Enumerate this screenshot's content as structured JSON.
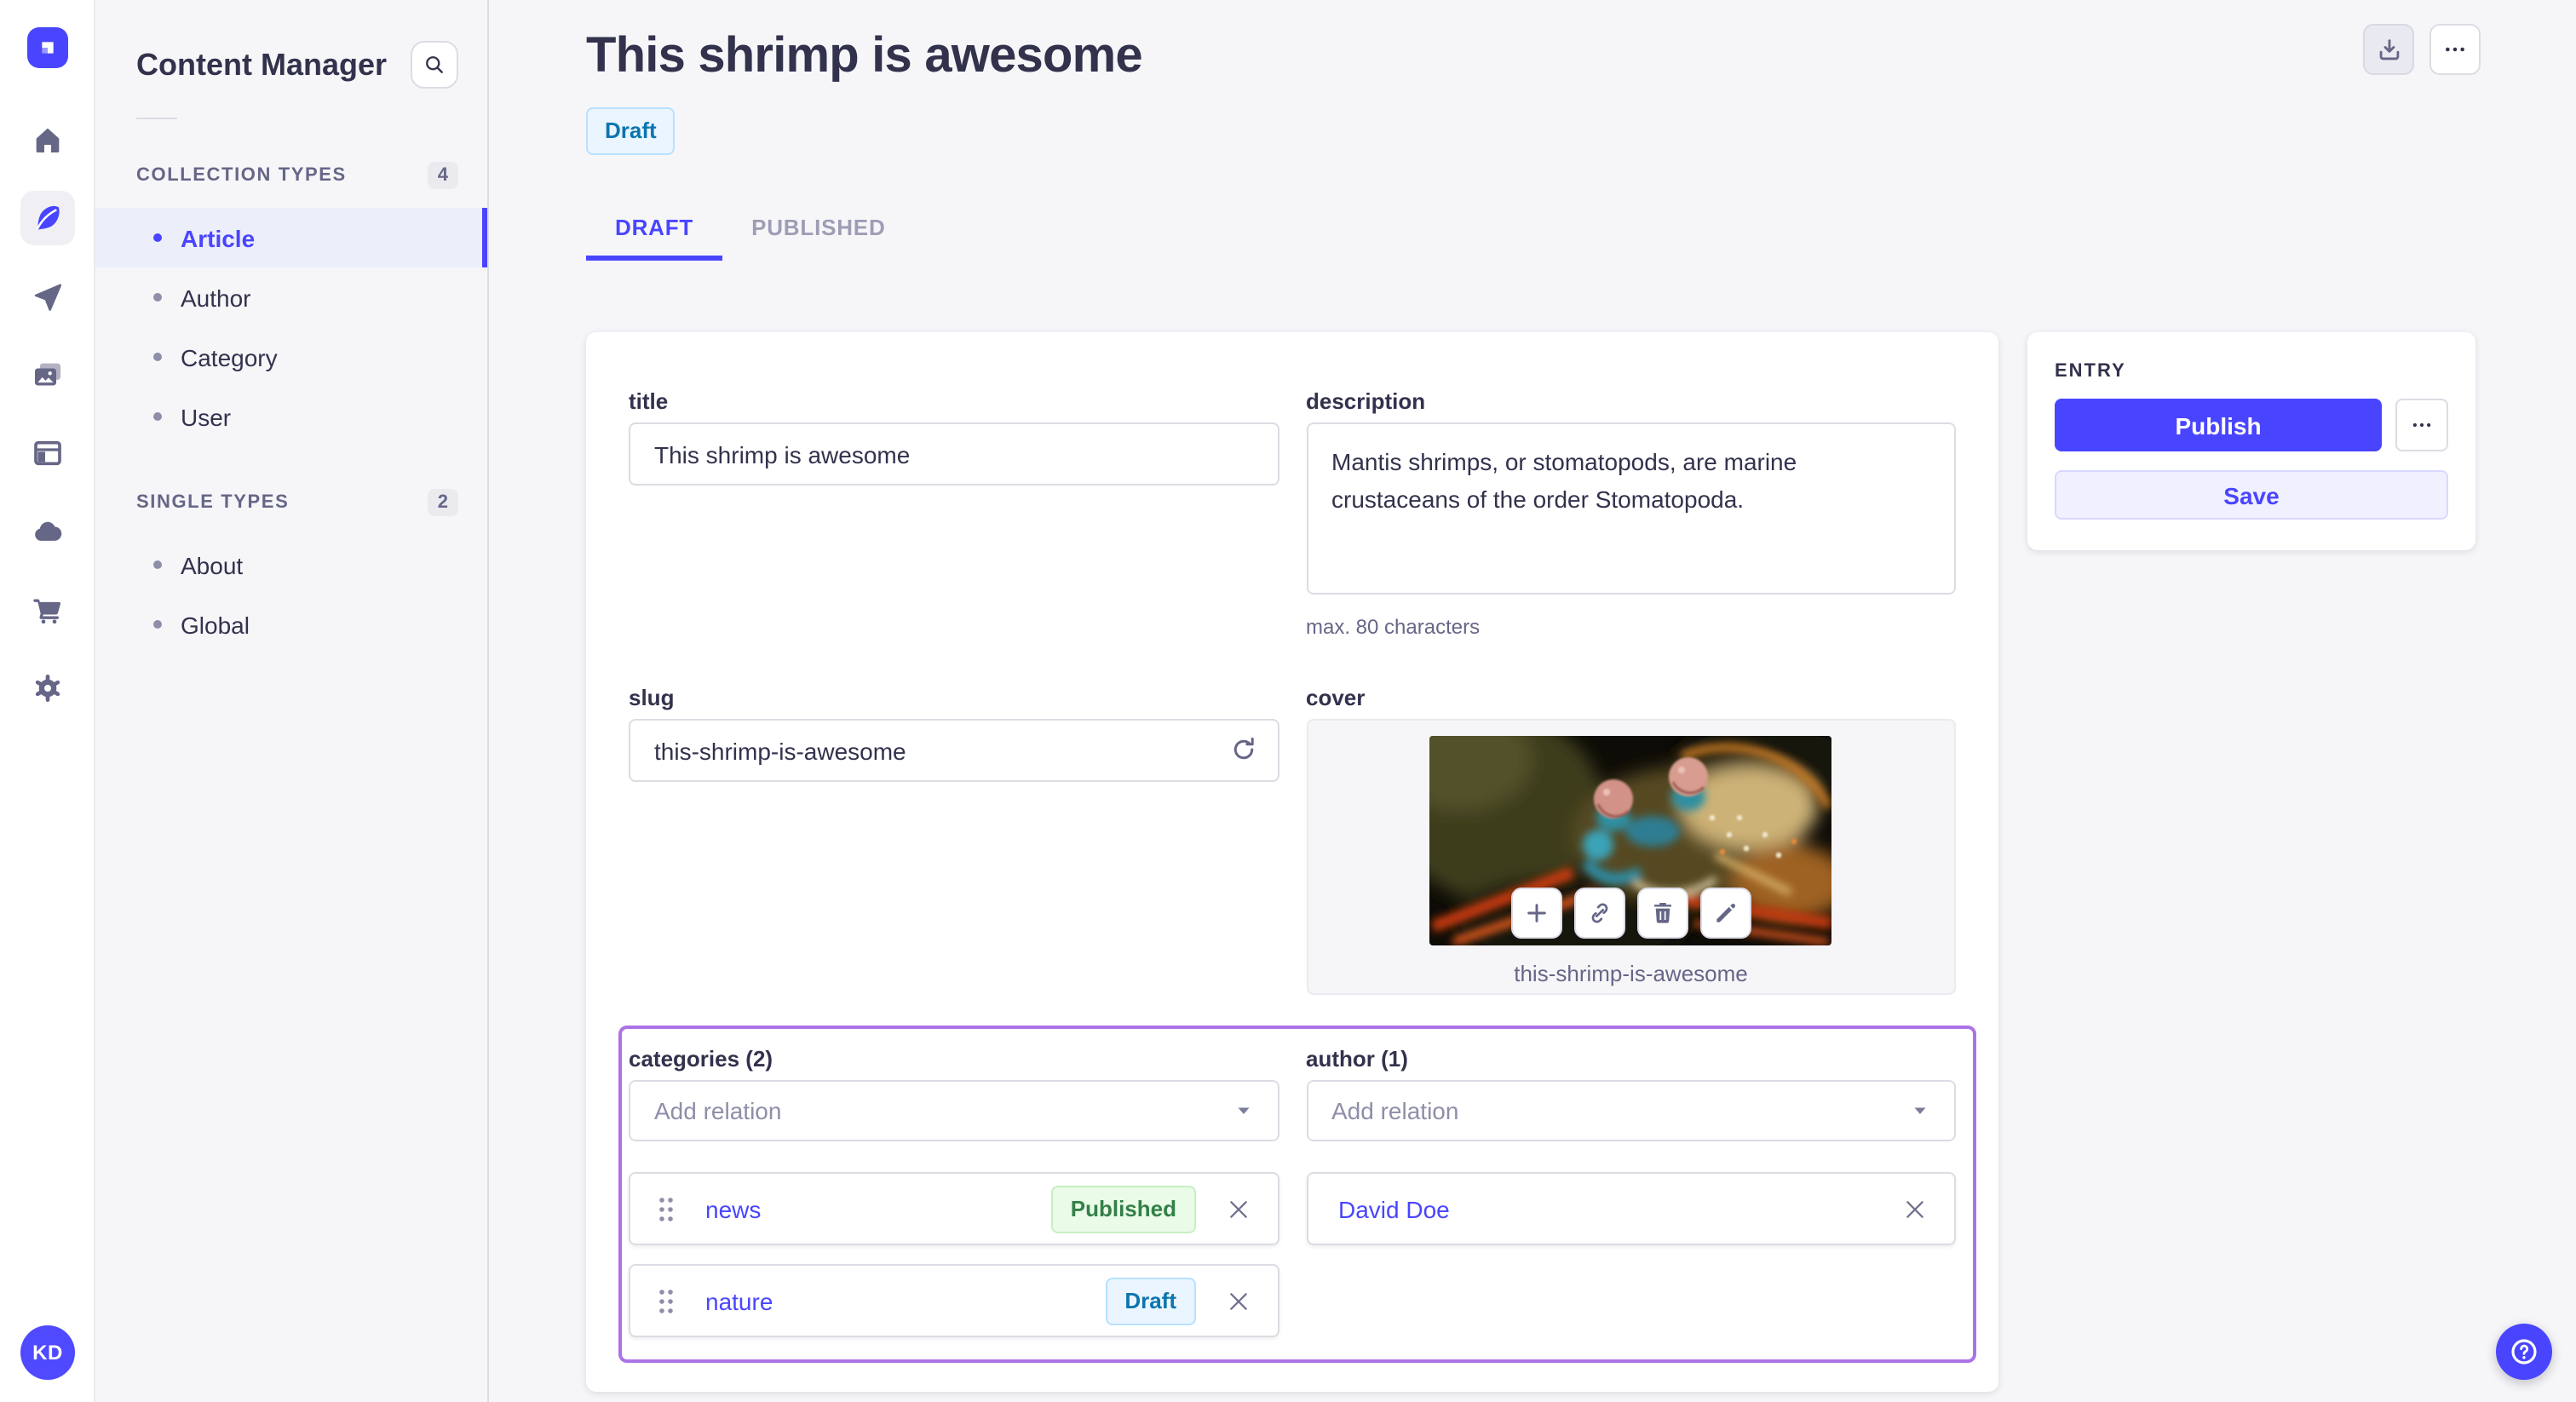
{
  "app": {
    "brand": "strapi",
    "user": {
      "initials": "KD"
    }
  },
  "colors": {
    "primary": "#4945ff",
    "primary_light": "#f0f0ff",
    "highlight_border": "#ac73e6",
    "draft_text": "#0c75af",
    "draft_bg": "#eaf5ff",
    "published_text": "#328048",
    "published_bg": "#eafbe7",
    "background": "#f6f6f9"
  },
  "icons": {
    "rail": [
      "home-icon",
      "feather-icon",
      "send-icon",
      "media-icon",
      "layout-icon",
      "cloud-icon",
      "cart-icon",
      "gear-icon"
    ],
    "header": [
      "download-icon",
      "more-icon"
    ],
    "cover_actions": [
      "plus-icon",
      "link-icon",
      "trash-icon",
      "pencil-icon"
    ],
    "misc": [
      "search-icon",
      "refresh-icon",
      "chevron-down-icon",
      "drag-handle-icon",
      "close-icon",
      "question-icon"
    ]
  },
  "sidebar": {
    "title": "Content Manager",
    "sections": [
      {
        "label": "COLLECTION TYPES",
        "count": "4",
        "items": [
          {
            "label": "Article",
            "active": true
          },
          {
            "label": "Author",
            "active": false
          },
          {
            "label": "Category",
            "active": false
          },
          {
            "label": "User",
            "active": false
          }
        ]
      },
      {
        "label": "SINGLE TYPES",
        "count": "2",
        "items": [
          {
            "label": "About",
            "active": false
          },
          {
            "label": "Global",
            "active": false
          }
        ]
      }
    ]
  },
  "header": {
    "title": "This shrimp is awesome",
    "status_badge": "Draft",
    "tabs": [
      {
        "label": "DRAFT",
        "active": true
      },
      {
        "label": "PUBLISHED",
        "active": false
      }
    ]
  },
  "form": {
    "title": {
      "label": "title",
      "value": "This shrimp is awesome"
    },
    "description": {
      "label": "description",
      "value": "Mantis shrimps, or stomatopods, are marine crustaceans of the order Stomatopoda.",
      "hint": "max. 80 characters"
    },
    "slug": {
      "label": "slug",
      "value": "this-shrimp-is-awesome"
    },
    "cover": {
      "label": "cover",
      "caption": "this-shrimp-is-awesome"
    },
    "categories": {
      "label": "categories (2)",
      "placeholder": "Add relation",
      "items": [
        {
          "name": "news",
          "status": "Published"
        },
        {
          "name": "nature",
          "status": "Draft"
        }
      ]
    },
    "author": {
      "label": "author (1)",
      "placeholder": "Add relation",
      "items": [
        {
          "name": "David Doe"
        }
      ]
    }
  },
  "entry_panel": {
    "title": "ENTRY",
    "publish_label": "Publish",
    "save_label": "Save"
  }
}
